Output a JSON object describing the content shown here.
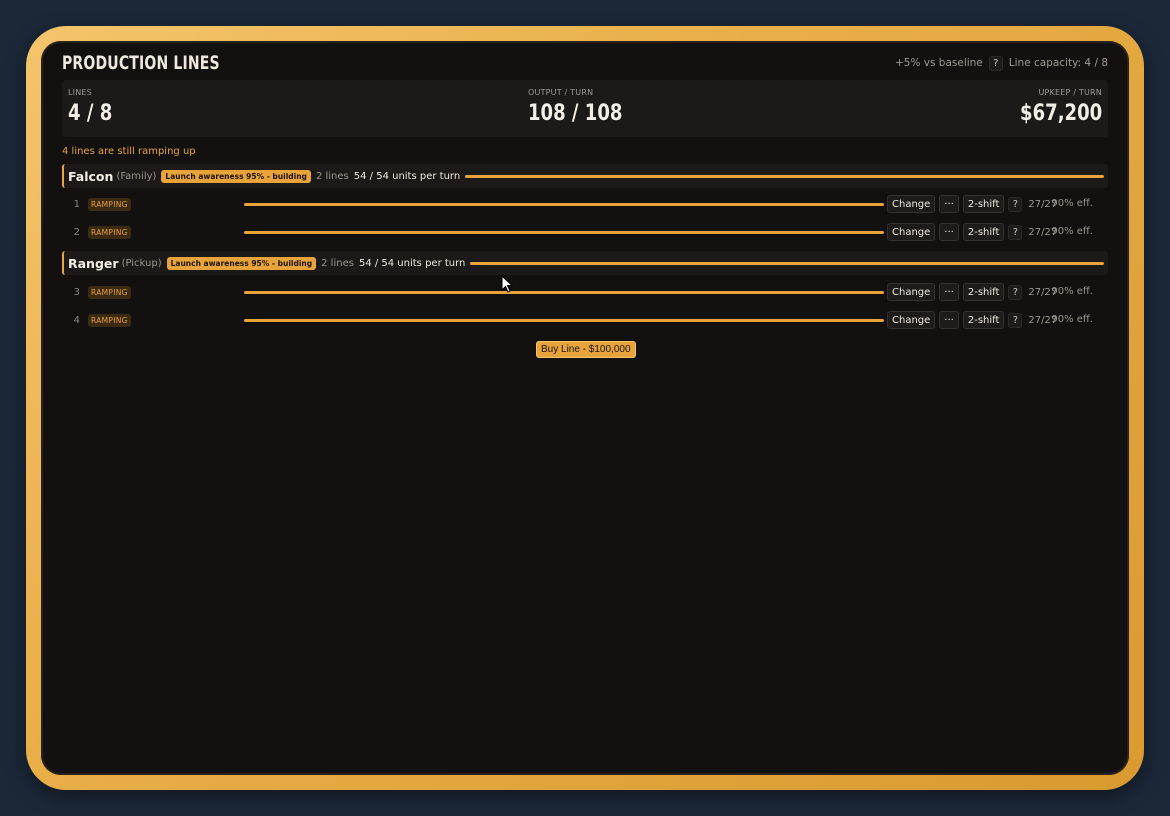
{
  "header": {
    "title": "PRODUCTION LINES",
    "baseline": "+5% vs baseline",
    "help": "?",
    "capacity": "Line capacity: 4 / 8"
  },
  "stats": {
    "lines_label": "LINES",
    "lines_value": "4 / 8",
    "output_label": "OUTPUT / TURN",
    "output_value": "108 / 108",
    "upkeep_label": "UPKEEP / TURN",
    "upkeep_value": "$67,200"
  },
  "warning": "4 lines are still ramping up",
  "groups": [
    {
      "name": "Falcon",
      "type": "(Family)",
      "badge": "Launch awareness 95% - building",
      "lines": "2 lines",
      "units": "54 / 54 units per turn",
      "rows": [
        {
          "num": "1",
          "status": "RAMPING",
          "change": "Change",
          "more": "···",
          "shift": "2-shift",
          "help": "?",
          "cap": "27/27",
          "eff": "90% eff."
        },
        {
          "num": "2",
          "status": "RAMPING",
          "change": "Change",
          "more": "···",
          "shift": "2-shift",
          "help": "?",
          "cap": "27/27",
          "eff": "90% eff."
        }
      ]
    },
    {
      "name": "Ranger",
      "type": "(Pickup)",
      "badge": "Launch awareness 95% - building",
      "lines": "2 lines",
      "units": "54 / 54 units per turn",
      "rows": [
        {
          "num": "3",
          "status": "RAMPING",
          "change": "Change",
          "more": "···",
          "shift": "2-shift",
          "help": "?",
          "cap": "27/27",
          "eff": "90% eff."
        },
        {
          "num": "4",
          "status": "RAMPING",
          "change": "Change",
          "more": "···",
          "shift": "2-shift",
          "help": "?",
          "cap": "27/27",
          "eff": "90% eff."
        }
      ]
    }
  ],
  "buy_button": "Buy Line - $100,000",
  "colors": {
    "accent": "#e8a43a",
    "frame": "#f4c46c",
    "background": "#121110"
  }
}
